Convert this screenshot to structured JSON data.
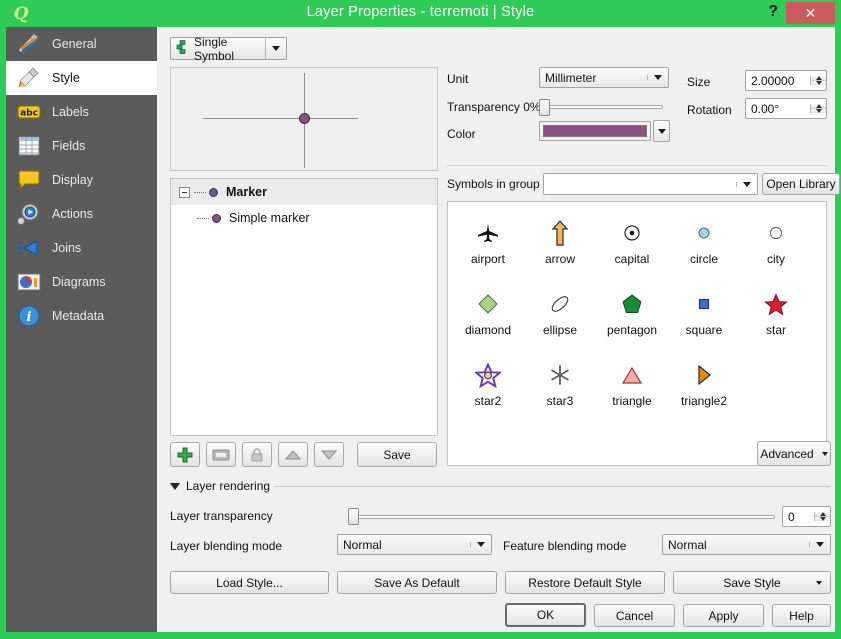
{
  "window": {
    "title": "Layer Properties - terremoti | Style",
    "logo": "qgis-logo",
    "help_label": "?",
    "close_label": "✕",
    "frame_color": "#2ecc57",
    "close_color": "#cc5c5c"
  },
  "sidebar": {
    "items": [
      {
        "label": "General",
        "icon": "hammer-wrench-icon",
        "active": false
      },
      {
        "label": "Style",
        "icon": "paintbrush-icon",
        "active": true
      },
      {
        "label": "Labels",
        "icon": "abc-label-icon",
        "active": false
      },
      {
        "label": "Fields",
        "icon": "table-grid-icon",
        "active": false
      },
      {
        "label": "Display",
        "icon": "speech-bubble-icon",
        "active": false
      },
      {
        "label": "Actions",
        "icon": "gear-play-icon",
        "active": false
      },
      {
        "label": "Joins",
        "icon": "join-arrow-icon",
        "active": false
      },
      {
        "label": "Diagrams",
        "icon": "pie-chart-icon",
        "active": false
      },
      {
        "label": "Metadata",
        "icon": "info-circle-icon",
        "active": false
      }
    ]
  },
  "renderer": {
    "selected": "Single Symbol",
    "icon": "single-symbol-icon"
  },
  "symbol_tree": {
    "rows": [
      {
        "label": "Marker",
        "level": 0,
        "selected": true,
        "bullet": "parent"
      },
      {
        "label": "Simple marker",
        "level": 1,
        "selected": false,
        "bullet": "child"
      }
    ]
  },
  "tree_tools": {
    "add_label": "add-symbol-layer",
    "remove_label": "remove-symbol-layer",
    "lock_label": "lock-layer-colors",
    "up_label": "move-up",
    "down_label": "move-down",
    "save_label": "Save"
  },
  "properties": {
    "unit_label": "Unit",
    "unit_value": "Millimeter",
    "transparency_label": "Transparency 0%",
    "transparency_value": 0,
    "color_label": "Color",
    "color_value": "#8c4f85",
    "size_label": "Size",
    "size_value": "2.00000",
    "rotation_label": "Rotation",
    "rotation_value": "0.00°"
  },
  "symbols_group": {
    "label": "Symbols in group",
    "value": "",
    "open_library_label": "Open Library"
  },
  "symbol_library": {
    "rows": [
      [
        {
          "name": "airport",
          "icon": "airplane-icon"
        },
        {
          "name": "arrow",
          "icon": "arrow-up-icon"
        },
        {
          "name": "capital",
          "icon": "capital-dot-icon"
        },
        {
          "name": "circle",
          "icon": "circle-icon"
        },
        {
          "name": "city",
          "icon": "city-ring-icon"
        }
      ],
      [
        {
          "name": "diamond",
          "icon": "diamond-icon"
        },
        {
          "name": "ellipse",
          "icon": "ellipse-icon"
        },
        {
          "name": "pentagon",
          "icon": "pentagon-icon"
        },
        {
          "name": "square",
          "icon": "square-icon"
        },
        {
          "name": "star",
          "icon": "star-icon"
        }
      ],
      [
        {
          "name": "star2",
          "icon": "star2-icon"
        },
        {
          "name": "star3",
          "icon": "star3-asterisk-icon"
        },
        {
          "name": "triangle",
          "icon": "triangle-icon"
        },
        {
          "name": "triangle2",
          "icon": "triangle2-right-icon"
        }
      ]
    ]
  },
  "advanced": {
    "label": "Advanced"
  },
  "layer_rendering": {
    "title": "Layer rendering",
    "transparency_label": "Layer transparency",
    "transparency_value": "0",
    "layer_blend_label": "Layer blending mode",
    "layer_blend_value": "Normal",
    "feature_blend_label": "Feature blending mode",
    "feature_blend_value": "Normal"
  },
  "style_buttons": {
    "load_style": "Load Style...",
    "save_as_default": "Save As Default",
    "restore_default": "Restore Default Style",
    "save_style": "Save Style"
  },
  "dialog_buttons": {
    "ok": "OK",
    "cancel": "Cancel",
    "apply": "Apply",
    "help": "Help"
  }
}
